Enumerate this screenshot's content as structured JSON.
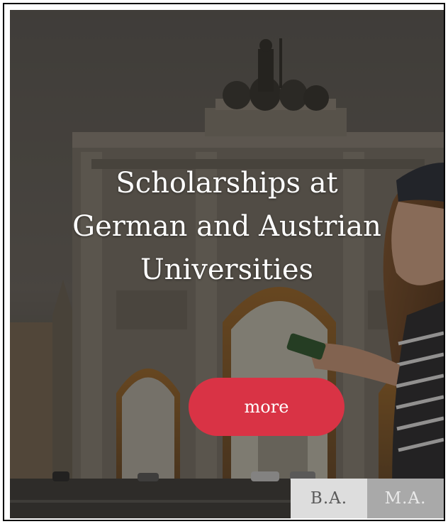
{
  "hero": {
    "headline_lines": [
      "Scholarships at",
      "German and Austrian",
      "Universities"
    ],
    "background_image": "victory-gate-and-student-with-phone",
    "overlay_color": "#19161499",
    "button_label": "more",
    "button_color": "#d93345"
  },
  "degree_tabs": [
    {
      "label": "B.A.",
      "color": "#dddddd"
    },
    {
      "label": "M.A.",
      "color": "#a9a9a9"
    }
  ]
}
